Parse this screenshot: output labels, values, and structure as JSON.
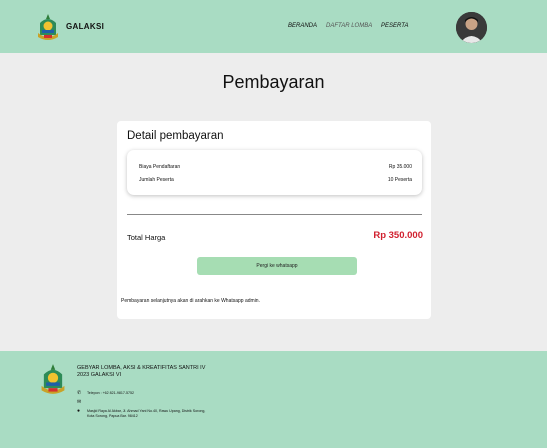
{
  "header": {
    "brand": "GALAKSI",
    "nav": [
      "BERANDA",
      "DAFTAR LOMBA",
      "PESERTA"
    ]
  },
  "page_title": "Pembayaran",
  "card": {
    "title": "Detail pembayaran",
    "rows": [
      {
        "label": "Biaya Pendaftaran",
        "value": "Rp 35.000"
      },
      {
        "label": "Jumlah Peserta",
        "value": "10 Peserta"
      }
    ],
    "total_label": "Total Harga",
    "total_value": "Rp 350.000",
    "button_label": "Pergi ke whatsapp",
    "note": "Pembayaran selanjutnya akan di arahkan ke Whatsapp admin."
  },
  "footer": {
    "title_line1": "GEBYAR LOMBA, AKSI & KREATIFITAS SANTRI IV",
    "title_line2": "2023 GALAKSI VI",
    "phone": "Telepon : +62 821-9817-5752",
    "email": "",
    "address_line1": "Masjid Raya Al Akbar, Jl. Ahmad Yani No.40, Rawu Upang, Distrik Sorong,",
    "address_line2": "Kota Sorong, Papua Bar. 98412"
  },
  "colors": {
    "header_bg": "#a9dcc3",
    "button_bg": "#a6ddb3",
    "total_color": "#d1202f",
    "page_bg": "#ededed"
  }
}
